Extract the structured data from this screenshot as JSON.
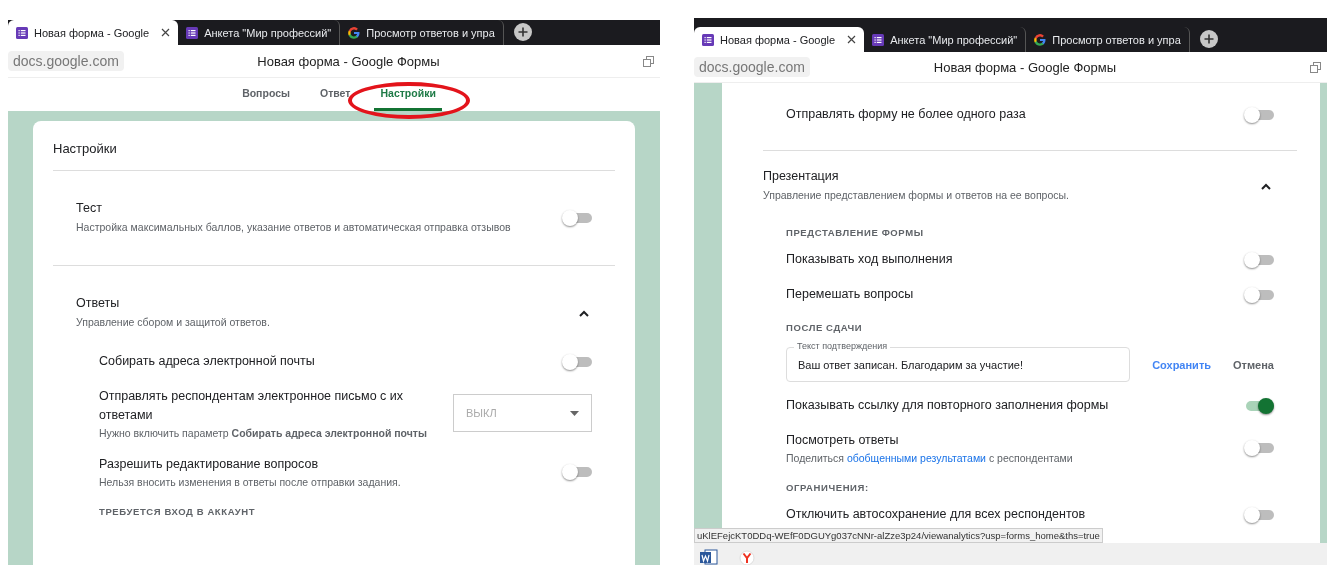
{
  "screenshots": [
    {
      "browser": {
        "tabs": [
          {
            "title": "Новая форма - Google",
            "kind": "forms",
            "selected": true
          },
          {
            "title": "Анкета \"Мир профессий\"",
            "kind": "forms",
            "selected": false
          },
          {
            "title": "Просмотр ответов и упра",
            "kind": "search",
            "selected": false
          }
        ],
        "address": "docs.google.com",
        "page_title": "Новая форма - Google Формы"
      },
      "form_tabs": [
        {
          "label": "Вопросы",
          "selected": false,
          "circled": false
        },
        {
          "label": "Ответ",
          "selected": false,
          "circled": false
        },
        {
          "label": "Настройки",
          "selected": true,
          "circled": true
        }
      ],
      "card": {
        "title": "Настройки",
        "sections": [
          {
            "kind": "toggle",
            "title": "Тест",
            "description": "Настройка максимальных баллов, указание ответов и автоматическая отправка отзывов",
            "on": false
          },
          {
            "kind": "expandable",
            "title": "Ответы",
            "description": "Управление сбором и защитой ответов.",
            "expanded": true,
            "children": [
              {
                "kind": "toggle",
                "label": "Собирать адреса электронной почты",
                "on": false
              },
              {
                "kind": "select",
                "label": "Отправлять респондентам электронное письмо с их ответами",
                "description": "Нужно включить параметр **Собирать адреса электронной почты**",
                "value": "ВЫКЛ",
                "disabled": true
              },
              {
                "kind": "toggle",
                "label": "Разрешить редактирование вопросов",
                "description": "Нельзя вносить изменения в ответы после отправки задания.",
                "on": false
              },
              {
                "kind": "subheading",
                "label": "ТРЕБУЕТСЯ ВХОД В АККАУНТ"
              }
            ]
          }
        ]
      }
    },
    {
      "browser": {
        "tabs": [
          {
            "title": "Новая форма - Google",
            "kind": "forms",
            "selected": true
          },
          {
            "title": "Анкета \"Мир профессий\"",
            "kind": "forms",
            "selected": false
          },
          {
            "title": "Просмотр ответов и упра",
            "kind": "search",
            "selected": false
          }
        ],
        "address": "docs.google.com",
        "page_title": "Новая форма - Google Формы"
      },
      "card": {
        "sections": [
          {
            "kind": "continued",
            "children": [
              {
                "kind": "toggle",
                "label": "Отправлять форму не более одного раза",
                "on": false
              }
            ]
          },
          {
            "kind": "expandable",
            "title": "Презентация",
            "description": "Управление представлением формы и ответов на ее вопросы.",
            "expanded": true,
            "children": [
              {
                "kind": "subheading",
                "label": "ПРЕДСТАВЛЕНИЕ ФОРМЫ"
              },
              {
                "kind": "toggle",
                "label": "Показывать ход выполнения",
                "on": false
              },
              {
                "kind": "toggle",
                "label": "Перемешать вопросы",
                "on": false
              },
              {
                "kind": "subheading",
                "label": "ПОСЛЕ СДАЧИ"
              },
              {
                "kind": "text_field",
                "label": "Текст подтверждения",
                "value": "Ваш ответ записан. Благодарим за участие!",
                "actions": [
                  {
                    "label": "Сохранить",
                    "kind": "primary"
                  },
                  {
                    "label": "Отмена",
                    "kind": "secondary"
                  }
                ]
              },
              {
                "kind": "toggle",
                "label": "Показывать ссылку для повторного заполнения формы",
                "on": true
              },
              {
                "kind": "toggle",
                "label": "Посмотреть ответы",
                "description_parts": [
                  {
                    "text": "Поделиться",
                    "kind": "text"
                  },
                  {
                    "text": "обобщенными результатами",
                    "kind": "link"
                  },
                  {
                    "text": "с респондентами",
                    "kind": "text"
                  }
                ],
                "on": false
              },
              {
                "kind": "subheading",
                "label": "ОГРАНИЧЕНИЯ:"
              },
              {
                "kind": "toggle",
                "label": "Отключить автосохранение для всех респондентов",
                "on": false
              }
            ]
          }
        ]
      },
      "status_url": "uKlEFejcKT0DDq-WEfF0DGUYg037cNNr-alZze3p24/viewanalytics?usp=forms_home&ths=true",
      "taskbar": [
        {
          "kind": "document"
        },
        {
          "kind": "browser"
        }
      ]
    }
  ]
}
